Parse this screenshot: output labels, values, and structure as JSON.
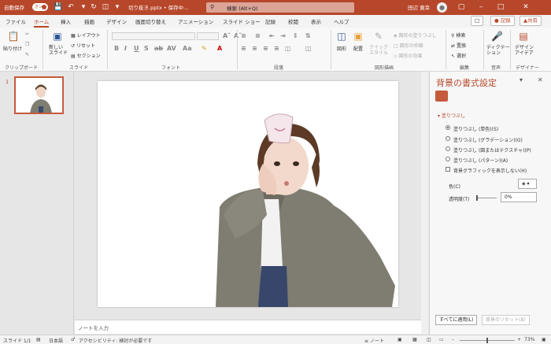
{
  "titlebar": {
    "autosave_label": "自動保存",
    "autosave_toggle": "オン",
    "filename": "切り抜き.pptx • 保存中...",
    "search_placeholder": "検索 (Alt+Q)",
    "user_name": "田辺 寛幸"
  },
  "tabs": [
    "ファイル",
    "ホーム",
    "挿入",
    "描画",
    "デザイン",
    "画面切り替え",
    "アニメーション",
    "スライド ショー",
    "記録",
    "校閲",
    "表示",
    "ヘルプ"
  ],
  "active_tab": "ホーム",
  "tab_buttons": {
    "record": "記録",
    "share": "共有"
  },
  "ribbon": {
    "clipboard": {
      "paste": "貼り付け",
      "label": "クリップボード"
    },
    "slides": {
      "new_slide": "新しい\nスライド",
      "layout": "レイアウト",
      "reset": "リセット",
      "section": "セクション",
      "label": "スライド"
    },
    "font": {
      "label": "フォント"
    },
    "paragraph": {
      "label": "段落"
    },
    "drawing": {
      "shape": "図形",
      "arrange": "配置",
      "quick_style": "クイック\nスタイル",
      "fill": "図形の塗りつぶし",
      "outline": "図形の枠線",
      "effect": "図形の効果",
      "label": "図形描画"
    },
    "editing": {
      "find": "検索",
      "replace": "置換",
      "select": "選択",
      "label": "編集"
    },
    "voice": {
      "dictate": "ディクテー\nション",
      "label": "音声"
    },
    "designer": {
      "design_ideas": "デザイン\nアイデア",
      "label": "デザイナー"
    }
  },
  "thumbnails": [
    {
      "number": "1"
    }
  ],
  "notes_placeholder": "ノートを入力",
  "format_pane": {
    "title": "背景の書式設定",
    "section": "塗りつぶし",
    "options": [
      {
        "label": "塗りつぶし (単色)(S)",
        "selected": true
      },
      {
        "label": "塗りつぶし (グラデーション)(G)",
        "selected": false
      },
      {
        "label": "塗りつぶし (図またはテクスチャ)(P)",
        "selected": false
      },
      {
        "label": "塗りつぶし (パターン)(A)",
        "selected": false
      }
    ],
    "hide_graphics": "背景グラフィックを表示しない(H)",
    "color_label": "色(C)",
    "transparency_label": "透明度(T)",
    "transparency_value": "0%",
    "apply_all": "すべてに適用(L)",
    "reset_bg": "背景のリセット(B)"
  },
  "statusbar": {
    "slide_info": "スライド 1/1",
    "language": "日本語",
    "accessibility": "アクセシビリティ: 検討が必要です",
    "notes": "ノート",
    "zoom": "73%"
  },
  "colors": {
    "accent": "#b7472a",
    "pane_title": "#b7472a"
  }
}
